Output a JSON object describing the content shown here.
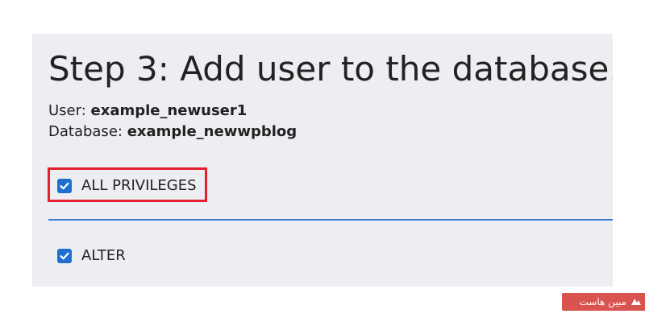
{
  "page": {
    "title": "Step 3: Add user to the database.",
    "user_label": "User: ",
    "user_value": "example_newuser1",
    "database_label": "Database: ",
    "database_value": "example_newwpblog"
  },
  "privileges": [
    {
      "label": "ALL PRIVILEGES",
      "checked": true,
      "highlighted": true
    },
    {
      "label": "ALTER",
      "checked": true,
      "highlighted": false
    }
  ],
  "watermark": {
    "text": "مبین هاست",
    "icon": "brand-logo-icon"
  },
  "colors": {
    "panel_bg": "#eceef2",
    "checkbox": "#1f6fd1",
    "highlight": "#e3202b",
    "divider": "#3b7dd0",
    "brand": "#d9534f"
  }
}
